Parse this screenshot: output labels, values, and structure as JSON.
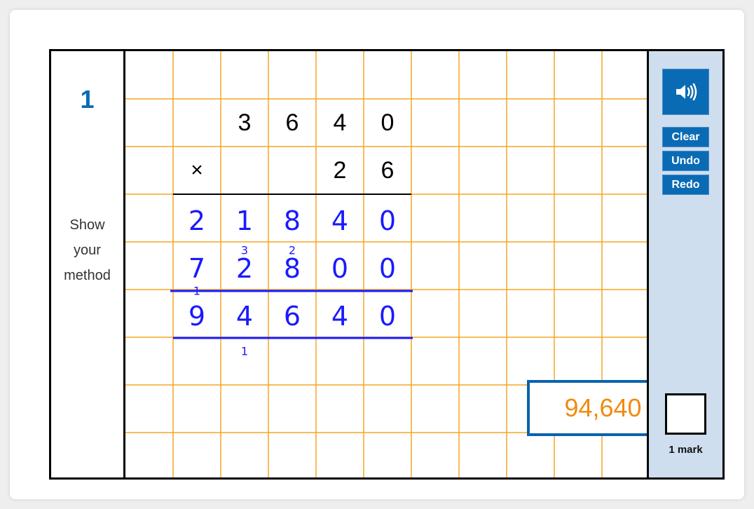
{
  "question": {
    "number": "1",
    "instruction_lines": [
      "Show",
      "your",
      "method"
    ]
  },
  "colors": {
    "accent": "#0a6bb5",
    "panel_bg": "#cfdeee",
    "grid_line": "#f5a623",
    "handwriting": "#1a1aff",
    "answer_text": "#f08a10"
  },
  "working": {
    "multiplicand": [
      "3",
      "6",
      "4",
      "0"
    ],
    "operator": "×",
    "multiplier": [
      "2",
      "6"
    ],
    "handwritten_rows": [
      {
        "row": 3,
        "digits": [
          "2",
          "1",
          "8",
          "4",
          "0"
        ]
      },
      {
        "row": 4,
        "digits": [
          "7",
          "2",
          "8",
          "0",
          "0"
        ],
        "carries": [
          {
            "col": 1,
            "value": "3"
          },
          {
            "col": 2,
            "value": "2"
          }
        ]
      },
      {
        "row": 5,
        "digits": [
          "9",
          "4",
          "6",
          "4",
          "0"
        ]
      }
    ],
    "carry_marks": [
      {
        "row": 5,
        "col": 0,
        "value": "1"
      },
      {
        "row": 6,
        "col": 1,
        "value": "1"
      }
    ]
  },
  "answer": {
    "value": "94,640"
  },
  "toolbar": {
    "audio_label": "speaker-icon",
    "clear_label": "Clear",
    "undo_label": "Undo",
    "redo_label": "Redo"
  },
  "marks": {
    "label": "1 mark"
  }
}
